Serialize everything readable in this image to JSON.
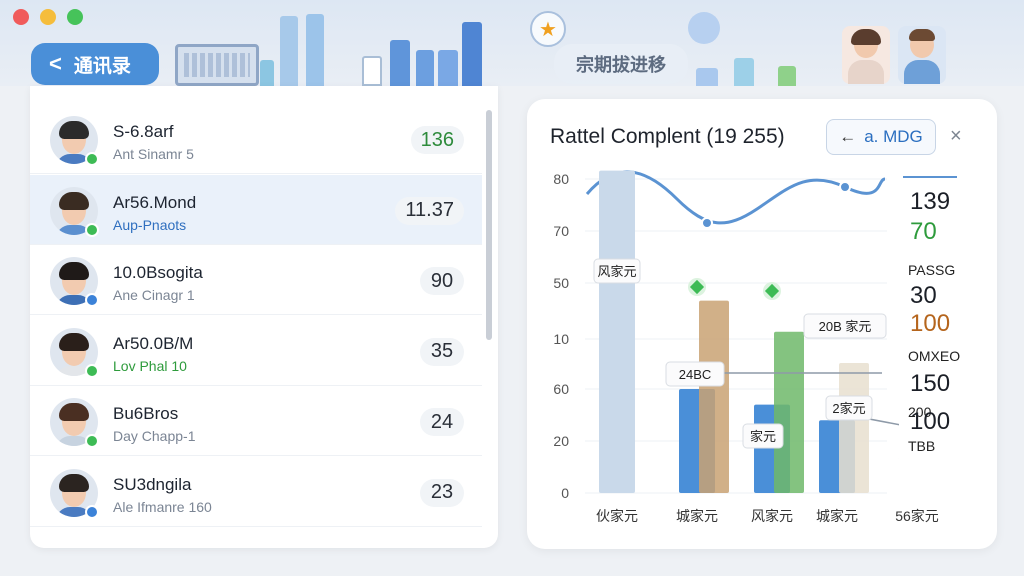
{
  "window": {
    "controls": [
      "close",
      "minimize",
      "zoom"
    ]
  },
  "header": {
    "back_label": "通讯录",
    "center_label": "宗期拔进移"
  },
  "contacts": [
    {
      "name": "S-6.8arf",
      "sub": "Ant Sinamr 5",
      "count": "136",
      "count_color": "#2e8b3c",
      "sub_color": "#7b8594",
      "status_color": "#3dbb55",
      "hair": "#2b2b2b",
      "shirt": "#4a7bc1",
      "selected": false
    },
    {
      "name": "Ar56.Mond",
      "sub": "Aup-Pnaots",
      "count": "11.37",
      "count_color": "#2a2f38",
      "sub_color": "#2f6fbf",
      "status_color": "#3dbb55",
      "hair": "#3a2c22",
      "shirt": "#5b8fcf",
      "selected": true
    },
    {
      "name": "10.0Bsogita",
      "sub": "Ane Cinagr 1",
      "count": "90",
      "count_color": "#2a2f38",
      "sub_color": "#7b8594",
      "status_color": "#3b82d8",
      "hair": "#1f1a18",
      "shirt": "#3d6fb5",
      "selected": false
    },
    {
      "name": "Ar50.0B/M",
      "sub": "Lov Phal 10",
      "count": "35",
      "count_color": "#2a2f38",
      "sub_color": "#2e9b3c",
      "status_color": "#3dbb55",
      "hair": "#2a1f1a",
      "shirt": "#e3e6ea",
      "selected": false
    },
    {
      "name": "Bu6Bros",
      "sub": "Day Chapp-1",
      "count": "24",
      "count_color": "#2a2f38",
      "sub_color": "#7b8594",
      "status_color": "#3dbb55",
      "hair": "#4a2f22",
      "shirt": "#c7d3e0",
      "selected": false
    },
    {
      "name": "SU3dngila",
      "sub": "Ale Ifmanre 160",
      "count": "23",
      "count_color": "#2a2f38",
      "sub_color": "#7b8594",
      "status_color": "#3b82d8",
      "hair": "#2b2420",
      "shirt": "#4a7bc1",
      "selected": false
    }
  ],
  "chart_card": {
    "title": "Rattel Complent (19 255)",
    "button_label": "a. MDG",
    "close_symbol": "×"
  },
  "chart_data": {
    "type": "bar",
    "y_ticks": [
      "80",
      "70",
      "50",
      "10",
      "60",
      "20",
      "0"
    ],
    "categories": [
      "伙家元",
      "城家元",
      "风家元",
      "城家元",
      "56家元"
    ],
    "values": [
      62,
      20,
      17,
      14,
      7
    ],
    "secondary_values": [
      0,
      37,
      31,
      25,
      17
    ],
    "line_points": [
      "",
      "",
      "",
      "",
      ""
    ],
    "labels": [
      "风家元",
      "24BC",
      "家元",
      "20B 家元",
      "2家元"
    ],
    "side_values": [
      {
        "label": "",
        "value": "139",
        "color": "#1b1f27"
      },
      {
        "label": "",
        "value": "70",
        "color": "#2e9b3c"
      },
      {
        "label": "PASSG",
        "value": "30",
        "color": "#1b1f27"
      },
      {
        "label": "",
        "value": "100",
        "color": "#b5651d"
      },
      {
        "label": "OMXEO",
        "value": "150",
        "color": "#1b1f27"
      },
      {
        "label": "200",
        "value": "100",
        "color": "#1b1f27"
      },
      {
        "label": "TBB",
        "value": "",
        "color": "#1b1f27"
      }
    ],
    "colors": {
      "bar_primary": "#4a8fd8",
      "bar_green": "#6fb86a",
      "bar_brown": "#c9a273",
      "line": "#5b93d2",
      "diamond": "#3dbb55"
    }
  }
}
